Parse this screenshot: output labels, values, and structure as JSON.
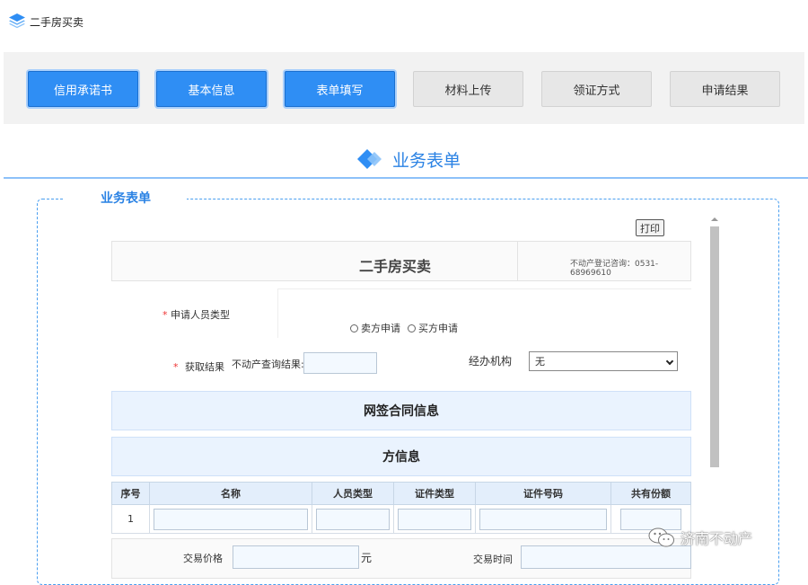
{
  "app": {
    "title": "二手房买卖",
    "icon": "layers-icon"
  },
  "steps": [
    {
      "label": "信用承诺书",
      "state": "active"
    },
    {
      "label": "基本信息",
      "state": "active"
    },
    {
      "label": "表单填写",
      "state": "active"
    },
    {
      "label": "材料上传",
      "state": "inactive"
    },
    {
      "label": "领证方式",
      "state": "inactive"
    },
    {
      "label": "申请结果",
      "state": "inactive"
    }
  ],
  "section": {
    "title": "业务表单",
    "icon": "diamond-icon"
  },
  "fieldset": {
    "legend": "业务表单"
  },
  "form": {
    "print_label": "打印",
    "doc_title": "二手房买卖",
    "hotline": "不动产登记咨询：0531-68969610",
    "applicant_type": {
      "required_mark": "*",
      "label": "申请人员类型",
      "options": [
        "卖方申请",
        "买方申请"
      ]
    },
    "result": {
      "required_mark": "*",
      "label": "获取结果",
      "query_label": "不动产查询结果:",
      "query_value": ""
    },
    "agency": {
      "label": "经办机构",
      "selected": "无"
    },
    "band1": "网签合同信息",
    "band2": "方信息",
    "table": {
      "headers": [
        "序号",
        "名称",
        "人员类型",
        "证件类型",
        "证件号码",
        "共有份额"
      ],
      "rows": [
        {
          "index": "1"
        }
      ]
    },
    "trade": {
      "price_label": "交易价格",
      "price_unit": "元",
      "time_label": "交易时间"
    }
  },
  "watermark": {
    "text": "济南不动产",
    "icon": "wechat-icon"
  },
  "colors": {
    "accent": "#2f8ef4",
    "band": "#eaf3fe",
    "required": "#e33333"
  }
}
